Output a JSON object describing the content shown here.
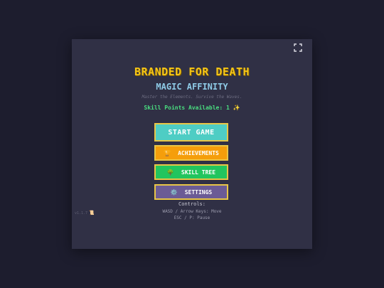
{
  "game": {
    "title": "BRANDED FOR DEATH",
    "subtitle": "MAGIC AFFINITY",
    "tagline": "Master the Elements. Survive the Waves.",
    "skill_points": "Skill Points Available: 1 ✨",
    "version": "v1.1.7"
  },
  "menu": {
    "start": "START GAME",
    "achievements": "ACHIEVEMENTS",
    "achievements_icon": "🏆",
    "skill_tree": "SKILL TREE",
    "skill_tree_icon": "🌳",
    "settings": "SETTINGS",
    "settings_icon": "⚙️"
  },
  "controls": {
    "title": "Controls:",
    "move": "WASD / Arrow Keys: Move",
    "pause": "ESC / P: Pause"
  },
  "colors": {
    "page_background": "#1d1d2e",
    "panel_background": "#303045",
    "title": "#f5c518",
    "subtitle": "#8ecae6",
    "skill_points": "#4ade80",
    "start_button": "#4ecdc4",
    "achievements_button": "#f59e0b",
    "skill_tree_button": "#22c55e",
    "settings_button": "#6b5b95",
    "button_border": "#e8c547"
  },
  "icons": {
    "fullscreen": "fullscreen-icon",
    "version_scroll": "scroll-icon"
  }
}
